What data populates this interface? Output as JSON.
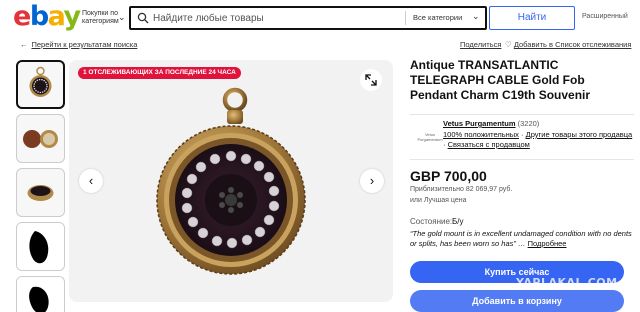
{
  "header": {
    "logo": "ebay",
    "shop_by_category": "Покупки по категориям",
    "search_placeholder": "Найдите любые товары",
    "category_select": "Все категории",
    "find_button": "Найти",
    "advanced": "Расширенный"
  },
  "nav": {
    "back_link": "Перейти к результатам поиска",
    "share": "Поделиться",
    "add_watch": "Добавить в Список отслеживания"
  },
  "gallery": {
    "watch_badge": "1 ОТСЛЕЖИВАЮЩИХ ЗА ПОСЛЕДНИЕ 24 ЧАСА",
    "thumbnails_count": 5,
    "active_thumbnail": 1
  },
  "item": {
    "title": "Antique TRANSATLANTIC TELEGRAPH CABLE Gold Fob Pendant Charm C19th Souvenir",
    "price": "GBP 700,00",
    "approx_price": "Приблизительно 82 069,97 руб.",
    "best_offer": "или Лучшая цена",
    "condition_label": "Состояние:",
    "condition_value": "Б/у",
    "condition_quote": "“The gold mount is in excellent undamaged condition with no dents or splits, has been worn so has” …",
    "condition_more": "Подробнее",
    "buy_now": "Купить сейчас",
    "add_to_cart": "Добавить в корзину"
  },
  "seller": {
    "logo_text": "Vetus Purgamentum",
    "name": "Vetus Purgamentum",
    "feedback_count": "(3220)",
    "positive": "100% положительных",
    "other_items": "Другие товары этого продавца",
    "contact": "Связаться с продавцом"
  },
  "watermark": "YAPLAKAL.COM",
  "colors": {
    "accent_blue": "#3665f3",
    "badge_red": "#e0133c"
  }
}
